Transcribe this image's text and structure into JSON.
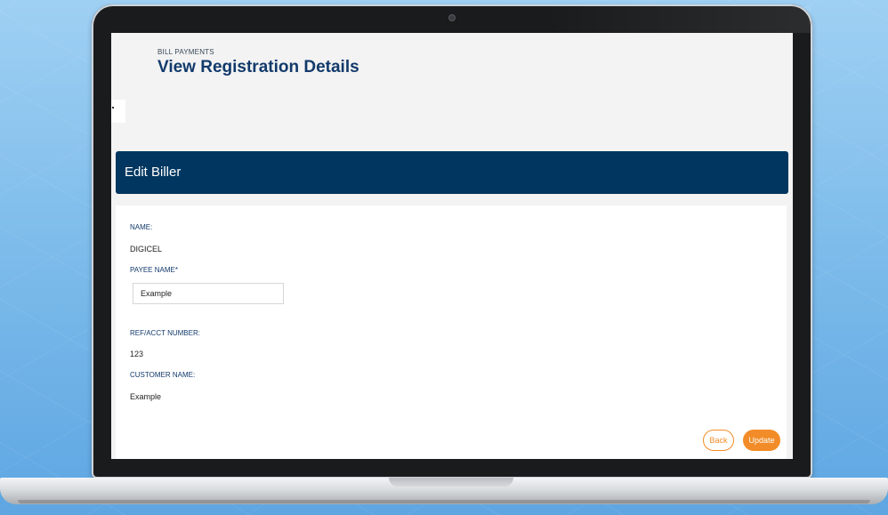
{
  "header": {
    "section": "BILL PAYMENTS",
    "title": "View Registration Details"
  },
  "card": {
    "title": "Edit Biller"
  },
  "form": {
    "name_label": "NAME:",
    "name_value": "DIGICEL",
    "payee_label": "PAYEE NAME*",
    "payee_value": "Example",
    "ref_label": "REF/ACCT NUMBER:",
    "ref_value": "123",
    "customer_label": "CUSTOMER NAME:",
    "customer_value": "Example"
  },
  "actions": {
    "back_label": "Back",
    "update_label": "Update"
  },
  "colors": {
    "header_bar": "#00365f",
    "accent": "#f28c28",
    "title": "#123a6b"
  }
}
